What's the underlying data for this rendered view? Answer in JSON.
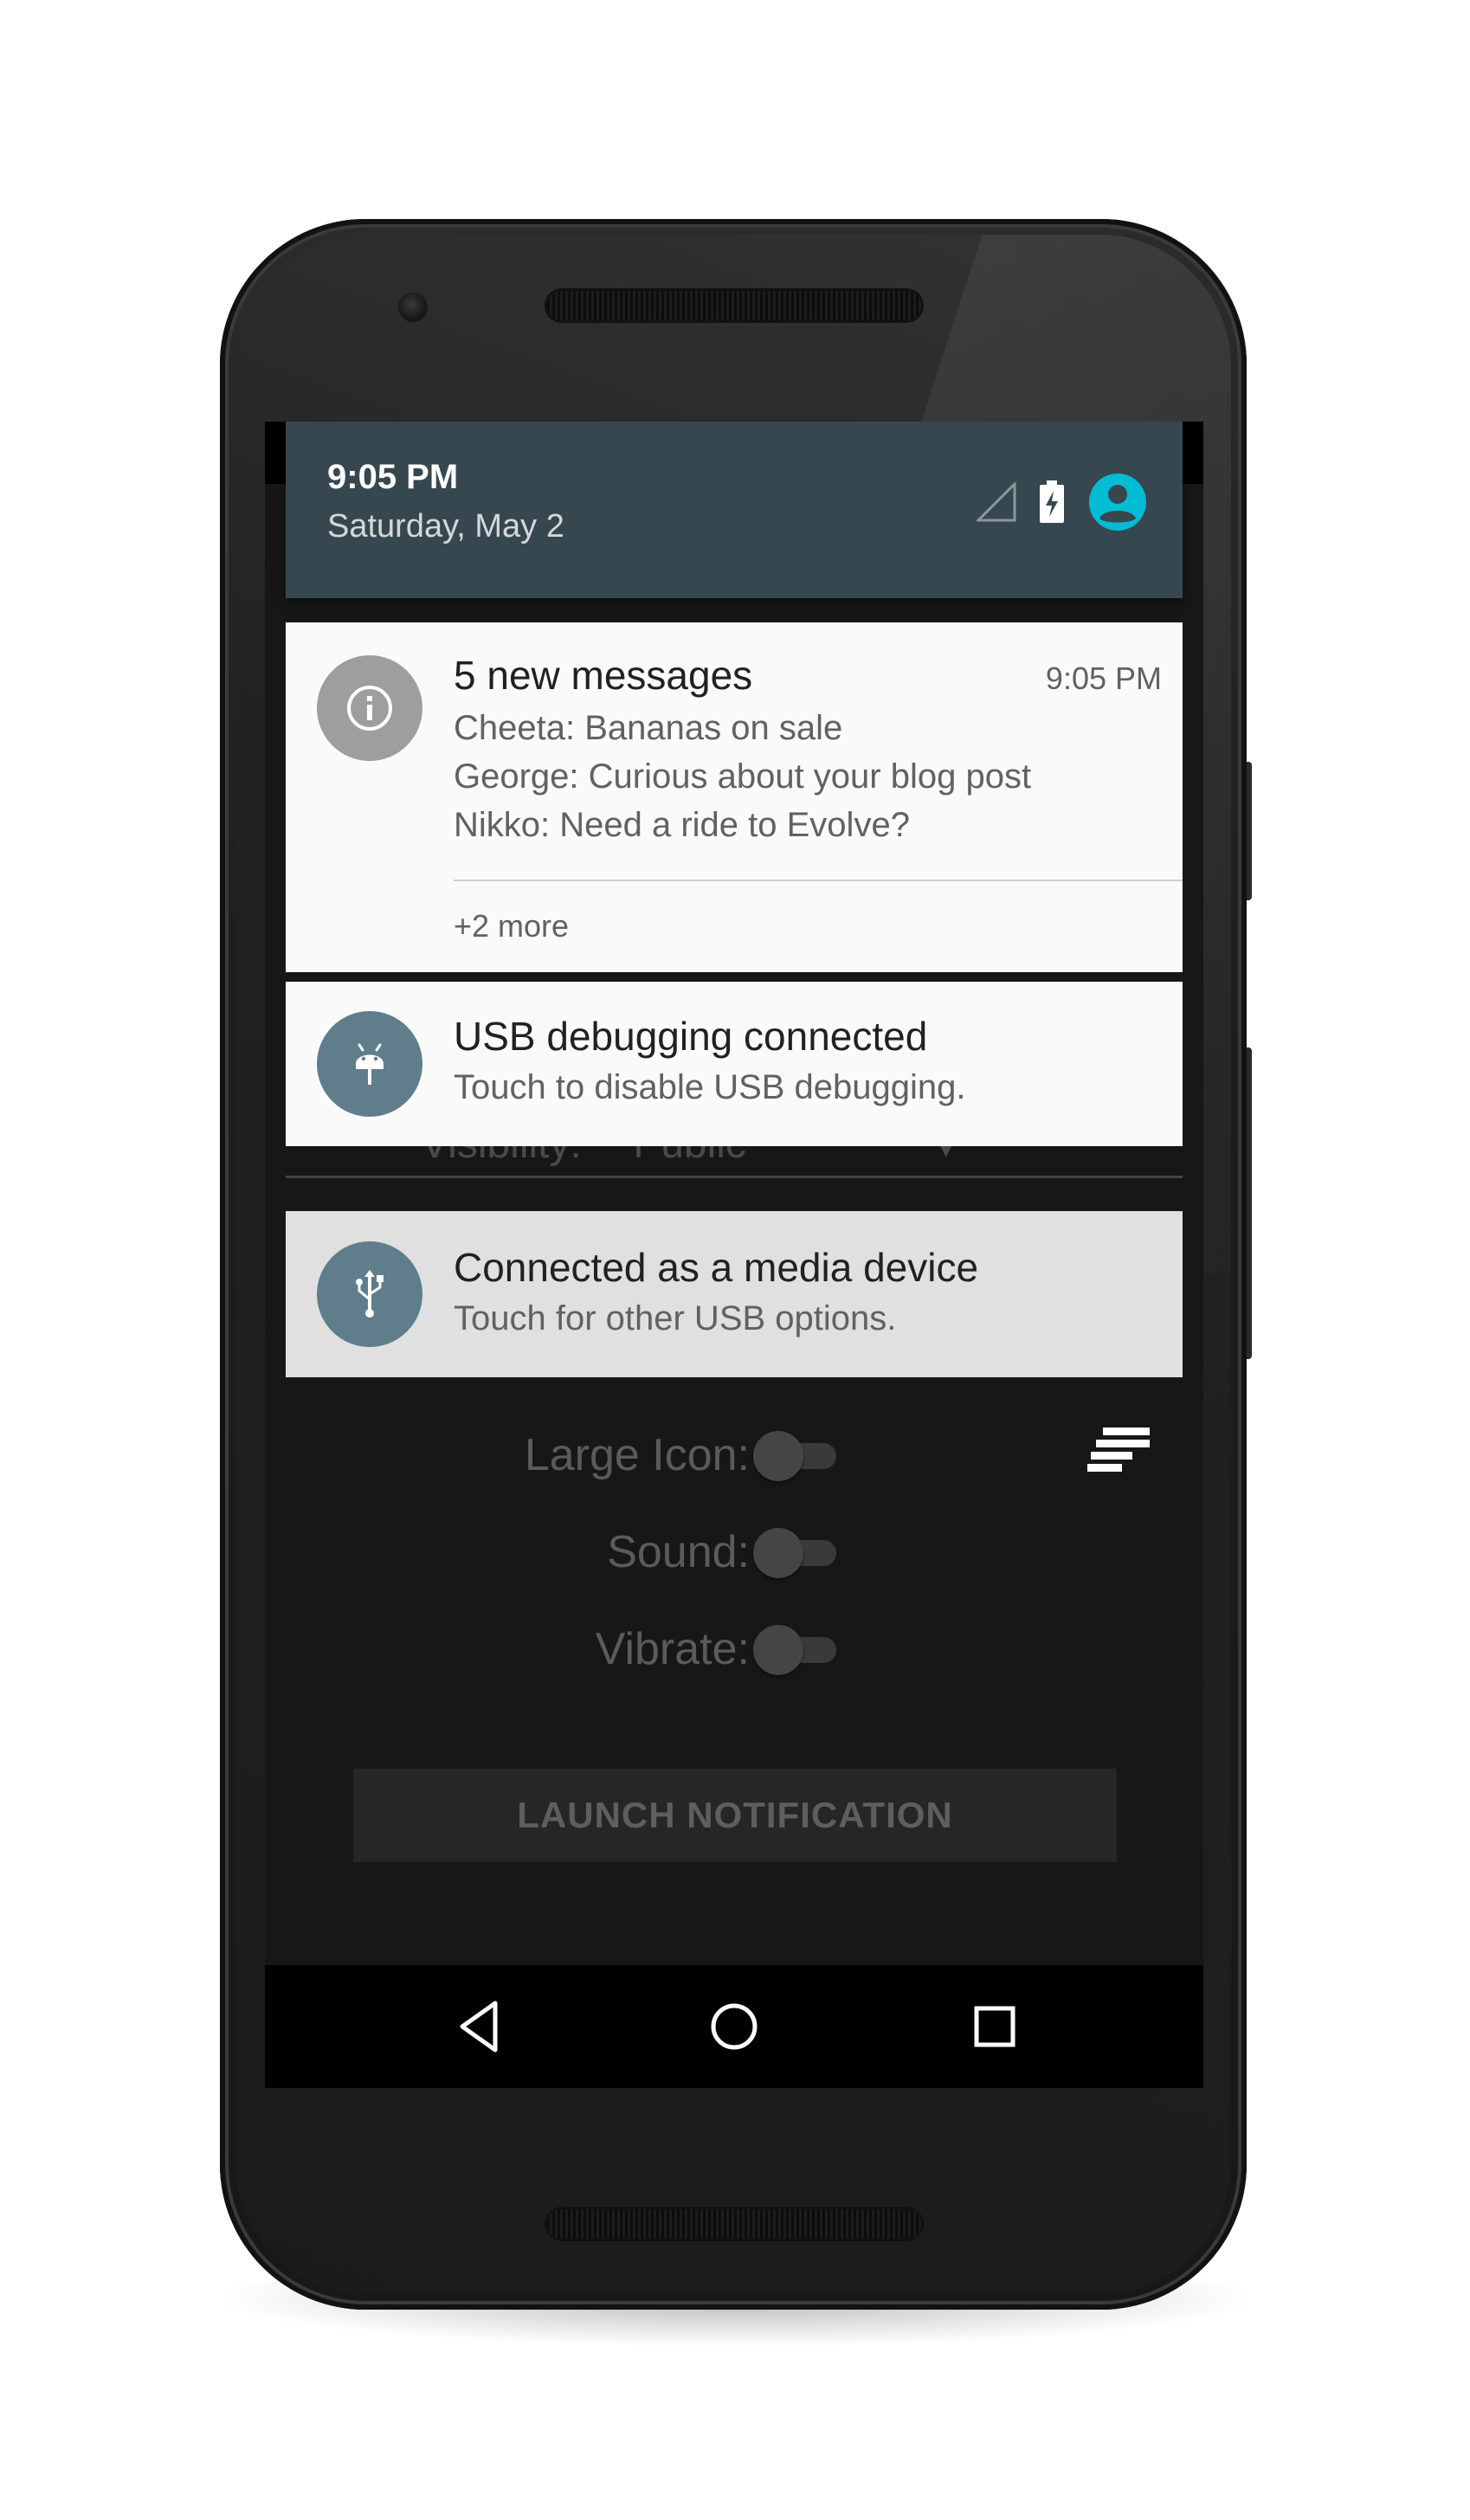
{
  "status_header": {
    "time": "9:05 PM",
    "date": "Saturday, May 2"
  },
  "icons": {
    "signal": "signal-icon",
    "battery": "battery-charging-icon",
    "account": "account-icon",
    "info": "info-icon",
    "android": "android-icon",
    "usb": "usb-icon",
    "list": "list-lines-icon",
    "back": "back-icon",
    "home": "home-icon",
    "recents": "recents-icon"
  },
  "colors": {
    "header_bg": "#37474f",
    "accent_cyan": "#00bcd4",
    "usb_avatar_bg": "#607d8b",
    "info_avatar_bg": "#9e9e9e"
  },
  "notifications": [
    {
      "title": "5 new messages",
      "time": "9:05 PM",
      "lines": [
        "Cheeta: Bananas on sale",
        "George: Curious about your blog post",
        "Nikko: Need a ride to Evolve?"
      ],
      "more": "+2 more"
    },
    {
      "title": "USB debugging connected",
      "text": "Touch to disable USB debugging."
    },
    {
      "title": "Connected as a media device",
      "text": "Touch for other USB options."
    }
  ],
  "app": {
    "visibility_label": "Visibility:",
    "visibility_value": "Public",
    "large_icon_label": "Large Icon:",
    "sound_label": "Sound:",
    "vibrate_label": "Vibrate:",
    "large_icon_on": false,
    "sound_on": false,
    "vibrate_on": false,
    "launch_button": "LAUNCH NOTIFICATION"
  }
}
